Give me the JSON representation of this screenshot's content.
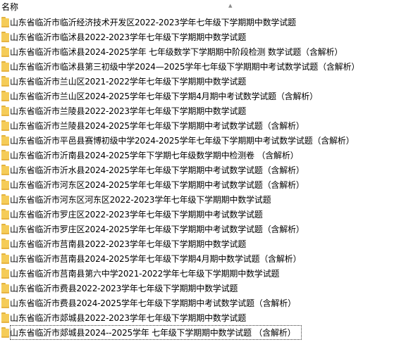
{
  "header": {
    "name_column": "名称"
  },
  "files": [
    "山东省临沂市临沂经济技术开发区2022-2023学年七年级下学期期中数学试题",
    "山东省临沂市临沭县2022-2023学年七年级下学期期中数学试题",
    "山东省临沂市临沭县2024-2025学年 七年级数学下学期期中阶段检测 数学试题（含解析）",
    "山东省临沂市临沭县第三初级中学2024—2025学年七年级下学期期中考试数学试题（含解析）",
    "山东省临沂市兰山区2021-2022学年七年级下学期期中数学试题",
    "山东省临沂市兰山区2024-2025学年七年级下学期4月期中考试数学试题（含解析）",
    "山东省临沂市兰陵县2022-2023学年七年级下学期期中数学试题",
    "山东省临沂市兰陵县2024-2025学年七年级下学期期中考试数学试题（含解析）",
    "山东省临沂市平邑县赛博初级中学2024-2025学年七年级下学期期中考试数学试题（含解析）",
    "山东省临沂市沂南县2024-2025学年下学期七年级数学期中检测卷 （含解析）",
    "山东省临沂市沂水县2024-2025学年七年级下学期期中考试数学试题（含解析）",
    "山东省临沂市河东区2024-2025学年七年级下学期期中考试数学试题（含解析）",
    "山东省临沂市河东区河东区2022-2023学年七年级下学期期中数学试题",
    "山东省临沂市罗庄区2022-2023学年七年级下学期期中考试数学试题",
    "山东省临沂市罗庄区2024-2025学年七年级下学期期中考试数学试题（含解析）",
    "山东省临沂市莒南县2022-2023学年七年级下学期期中数学试题",
    "山东省临沂市莒南县2024-2025学年七年级下学期4月期中数学试题（含解析）",
    "山东省临沂市莒南县第六中学2021-2022学年七年级下学期期中数学试题",
    "山东省临沂市费县2022-2023学年七年级下学期期中数学试题",
    "山东省临沂市费县2024-2025学年七年级下学期期中考试数学试题（含解析）",
    "山东省临沂市郯城县2022-2023学年七年级下学期期中数学试题",
    "山东省临沂市郯城县2024--2025学年 七年级下学期期中数学试题 （含解析）"
  ]
}
